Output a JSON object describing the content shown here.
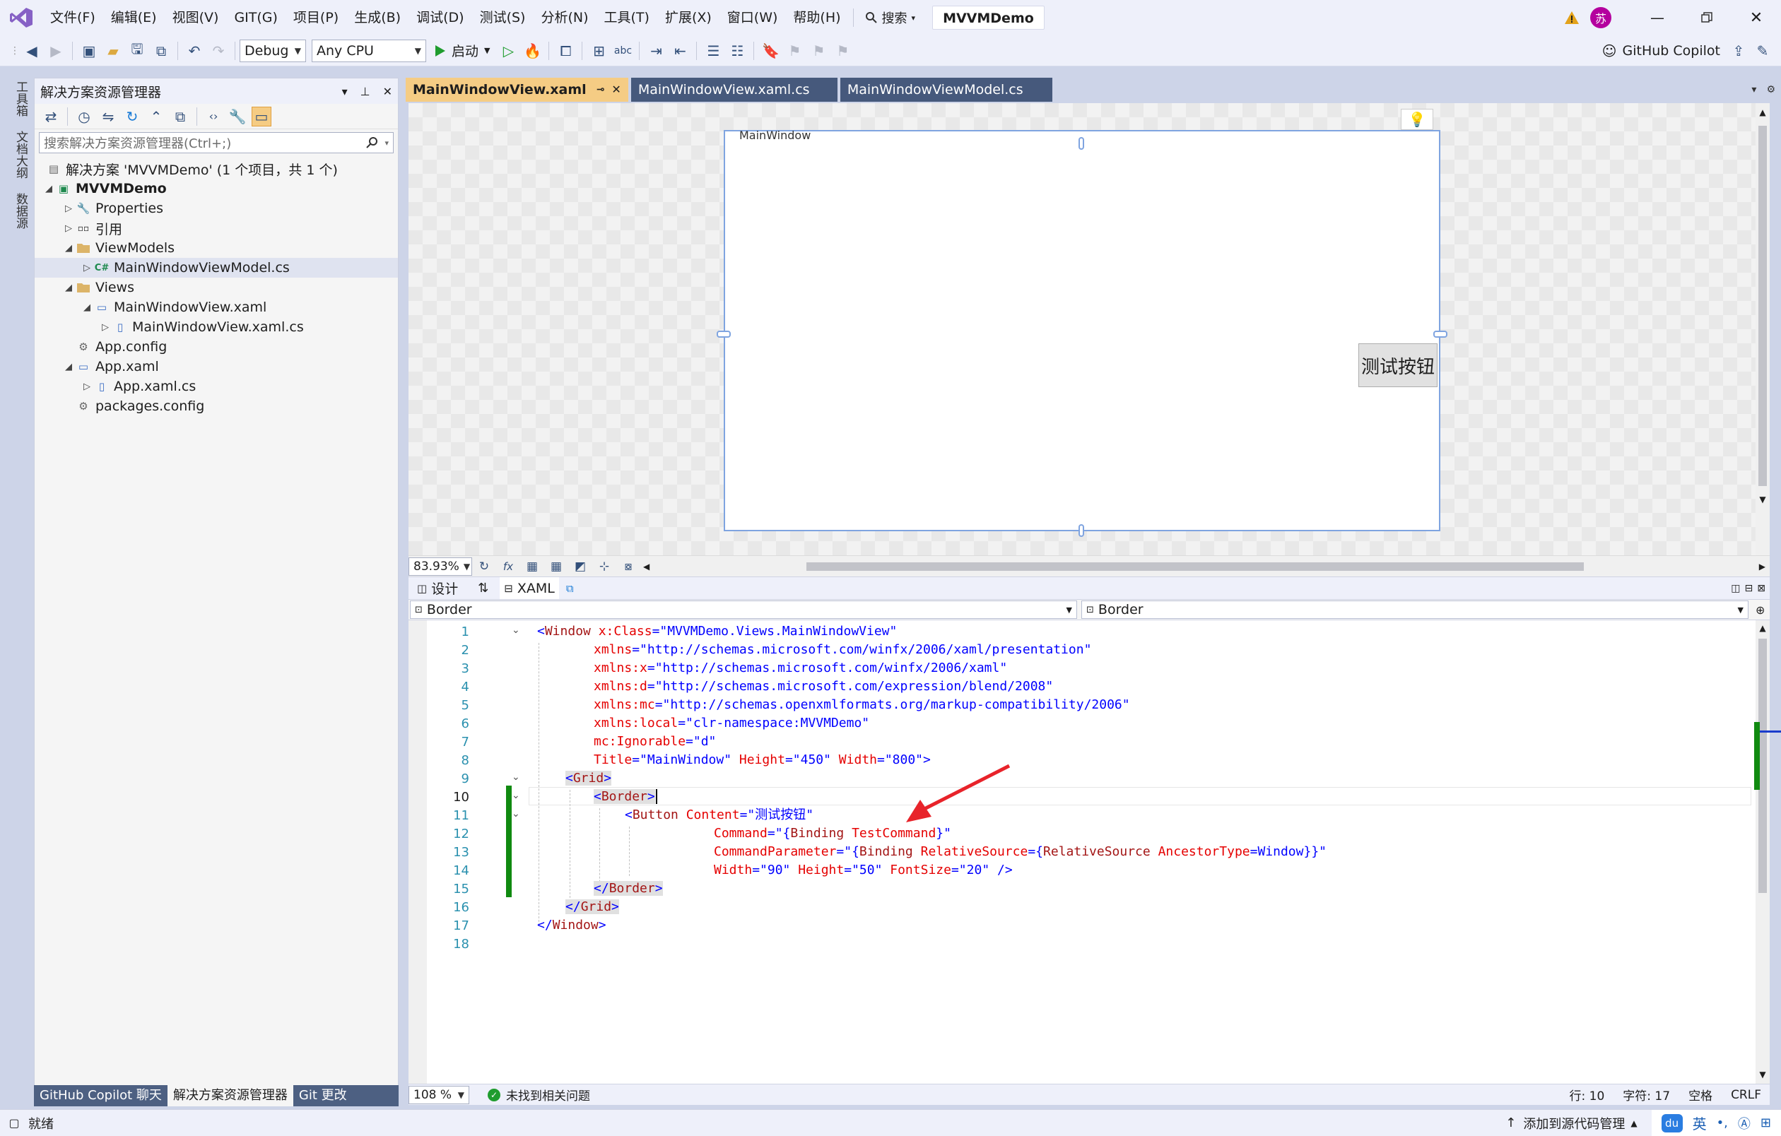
{
  "menu": [
    "文件(F)",
    "编辑(E)",
    "视图(V)",
    "GIT(G)",
    "项目(P)",
    "生成(B)",
    "调试(D)",
    "测试(S)",
    "分析(N)",
    "工具(T)",
    "扩展(X)",
    "窗口(W)",
    "帮助(H)"
  ],
  "header": {
    "search_label": "搜索",
    "solution_name": "MVVMDemo",
    "avatar_char": "苏"
  },
  "toolbar": {
    "configuration": "Debug",
    "platform": "Any CPU",
    "start_label": "启动",
    "copilot_label": "GitHub Copilot"
  },
  "side_tabs": [
    "工具箱",
    "文档大纲",
    "数据源"
  ],
  "solution_explorer": {
    "title": "解决方案资源管理器",
    "search_placeholder": "搜索解决方案资源管理器(Ctrl+;)",
    "tree": [
      {
        "label": "解决方案 'MVVMDemo' (1 个项目，共 1 个)"
      },
      {
        "label": "MVVMDemo"
      },
      {
        "label": "Properties"
      },
      {
        "label": "引用"
      },
      {
        "label": "ViewModels"
      },
      {
        "label": "MainWindowViewModel.cs"
      },
      {
        "label": "Views"
      },
      {
        "label": "MainWindowView.xaml"
      },
      {
        "label": "MainWindowView.xaml.cs"
      },
      {
        "label": "App.config"
      },
      {
        "label": "App.xaml"
      },
      {
        "label": "App.xaml.cs"
      },
      {
        "label": "packages.config"
      }
    ]
  },
  "bottom_tabs": [
    "GitHub Copilot 聊天",
    "解决方案资源管理器",
    "Git 更改"
  ],
  "doc_tabs": [
    "MainWindowView.xaml",
    "MainWindowView.xaml.cs",
    "MainWindowViewModel.cs"
  ],
  "designer": {
    "window_title": "MainWindow",
    "button_content": "测试按钮",
    "zoom": "83.93%"
  },
  "editor": {
    "split_tabs": [
      "设计",
      "XAML"
    ],
    "nav_left": "Border",
    "nav_right": "Border",
    "line_numbers": [
      "1",
      "2",
      "3",
      "4",
      "5",
      "6",
      "7",
      "8",
      "9",
      "10",
      "11",
      "12",
      "13",
      "14",
      "15",
      "16",
      "17",
      "18"
    ],
    "zoom": "108 %",
    "issues": "未找到相关问题",
    "line_info": "行: 10",
    "char_info": "字符: 17",
    "spaces": "空格",
    "line_ending": "CRLF"
  },
  "code": {
    "l1": [
      "<",
      "Window",
      " x:Class",
      "=\"MVVMDemo.Views.MainWindowView\""
    ],
    "l2": [
      "xmlns",
      "=\"http://schemas.microsoft.com/winfx/2006/xaml/presentation\""
    ],
    "l3": [
      "xmlns:x",
      "=\"http://schemas.microsoft.com/winfx/2006/xaml\""
    ],
    "l4": [
      "xmlns:d",
      "=\"http://schemas.microsoft.com/expression/blend/2008\""
    ],
    "l5": [
      "xmlns:mc",
      "=\"http://schemas.openxmlformats.org/markup-compatibility/2006\""
    ],
    "l6": [
      "xmlns:local",
      "=\"clr-namespace:MVVMDemo\""
    ],
    "l7": [
      "mc:Ignorable",
      "=\"d\""
    ],
    "l8": [
      "Title",
      "=\"MainWindow\"",
      " Height",
      "=\"450\"",
      " Width",
      "=\"800\">"
    ],
    "l9": [
      "<",
      "Grid",
      ">"
    ],
    "l10": [
      "<",
      "Border",
      ">"
    ],
    "l11": [
      "<",
      "Button",
      " Content",
      "=\"测试按钮\""
    ],
    "l12": [
      "Command",
      "=\"{",
      "Binding",
      " TestCommand",
      "}\""
    ],
    "l13": [
      "CommandParameter",
      "=\"{",
      "Binding",
      " RelativeSource",
      "={",
      "RelativeSource",
      " AncestorType",
      "=Window}}\""
    ],
    "l14": [
      "Width",
      "=\"90\"",
      " Height",
      "=\"50\"",
      " FontSize",
      "=\"20\" />"
    ],
    "l15": [
      "</",
      "Border",
      ">"
    ],
    "l16": [
      "</",
      "Grid",
      ">"
    ],
    "l17": [
      "</",
      "Window",
      ">"
    ]
  },
  "status": {
    "ready": "就绪",
    "source_control": "添加到源代码管理",
    "ime_lang": "英"
  }
}
